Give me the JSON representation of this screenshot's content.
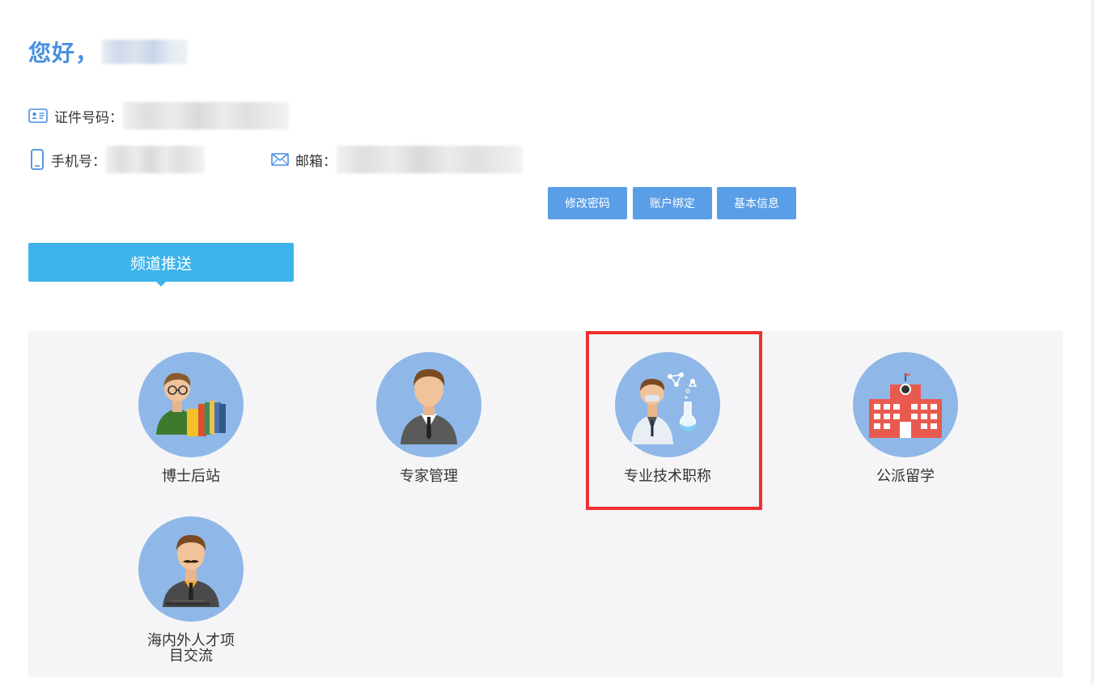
{
  "greeting": {
    "text": "您好，"
  },
  "profile": {
    "id_label": "证件号码：",
    "phone_label": "手机号：",
    "email_label": "邮箱："
  },
  "actions": [
    {
      "label": "修改密码"
    },
    {
      "label": "账户绑定"
    },
    {
      "label": "基本信息"
    }
  ],
  "channel_tab": {
    "label": "频道推送"
  },
  "channels": [
    {
      "label": "博士后站",
      "icon": "scholar-books-icon"
    },
    {
      "label": "专家管理",
      "icon": "expert-suit-icon"
    },
    {
      "label": "专业技术职称",
      "icon": "scientist-lab-icon"
    },
    {
      "label": "公派留学",
      "icon": "school-building-icon"
    },
    {
      "label": "海内外人才项目交流",
      "icon": "mustache-man-icon"
    }
  ],
  "colors": {
    "accent": "#4a8fe0",
    "button": "#5a9ee8",
    "tab": "#3db3ea",
    "circle": "#8fb8e8",
    "highlight": "#f03030"
  }
}
